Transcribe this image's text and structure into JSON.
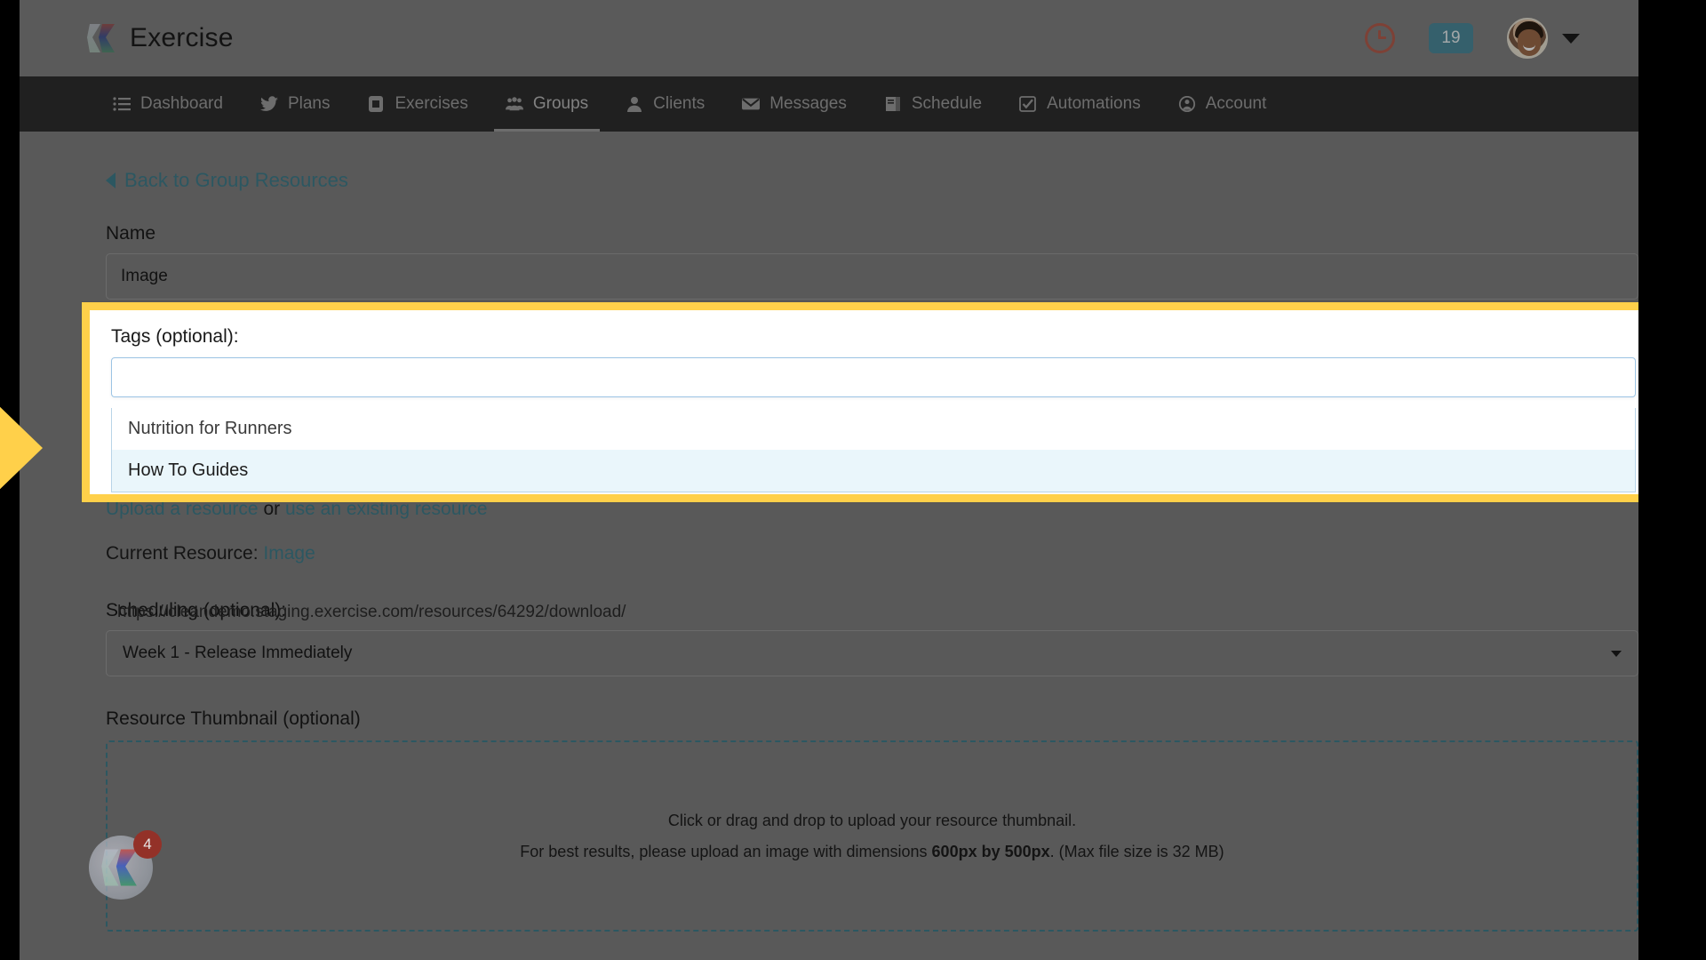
{
  "header": {
    "brand_name": "Exercise",
    "clock_icon": "clock-icon",
    "notification_count": "19",
    "avatar_icon": "user-avatar",
    "chevron_icon": "chevron-down-icon"
  },
  "nav": {
    "items": [
      {
        "label": "Dashboard",
        "icon": "list-icon",
        "active": false
      },
      {
        "label": "Plans",
        "icon": "bird-icon",
        "active": false
      },
      {
        "label": "Exercises",
        "icon": "phone-icon",
        "active": false
      },
      {
        "label": "Groups",
        "icon": "users-icon",
        "active": true
      },
      {
        "label": "Clients",
        "icon": "person-icon",
        "active": false
      },
      {
        "label": "Messages",
        "icon": "envelope-icon",
        "active": false
      },
      {
        "label": "Schedule",
        "icon": "book-icon",
        "active": false
      },
      {
        "label": "Automations",
        "icon": "check-square-icon",
        "active": false
      },
      {
        "label": "Account",
        "icon": "user-circle-icon",
        "active": false
      }
    ]
  },
  "main": {
    "back_link": "Back to Group Resources",
    "name_label": "Name",
    "name_value": "Image",
    "tags_label": "Tags (optional):",
    "tags_value": "",
    "tags_placeholder": "",
    "tag_options": [
      {
        "label": "Nutrition for Runners",
        "highlighted": false
      },
      {
        "label": "How To Guides",
        "highlighted": true
      }
    ],
    "resource_url": "https://cleandemo.staging.exercise.com/resources/64292/download/",
    "upload_link": "Upload a resource",
    "upload_or": " or ",
    "existing_link": "use an existing resource",
    "current_resource_label": "Current Resource: ",
    "current_resource_value": "Image",
    "scheduling_label": "Scheduling (optional):",
    "scheduling_value": "Week 1 - Release Immediately",
    "thumbnail_label": "Resource Thumbnail (optional)",
    "dropzone_line1": "Click or drag and drop to upload your resource thumbnail.",
    "dropzone_line2_pre": "For best results, please upload an image with dimensions ",
    "dropzone_line2_bold": "600px by 500px",
    "dropzone_line2_post": ". (Max file size is 32 MB)"
  },
  "widget": {
    "badge_count": "4",
    "icon": "exercise-logo-icon"
  },
  "annotation": {
    "arrow_icon": "right-arrow-pointer",
    "highlight_color": "#ffd04a"
  },
  "colors": {
    "accent_teal": "#3f7d8c",
    "nav_bg": "#2f2f2f",
    "badge_teal": "#4c8a9b",
    "clock_red": "#b85a4a",
    "highlight_yellow": "#ffd04a"
  }
}
